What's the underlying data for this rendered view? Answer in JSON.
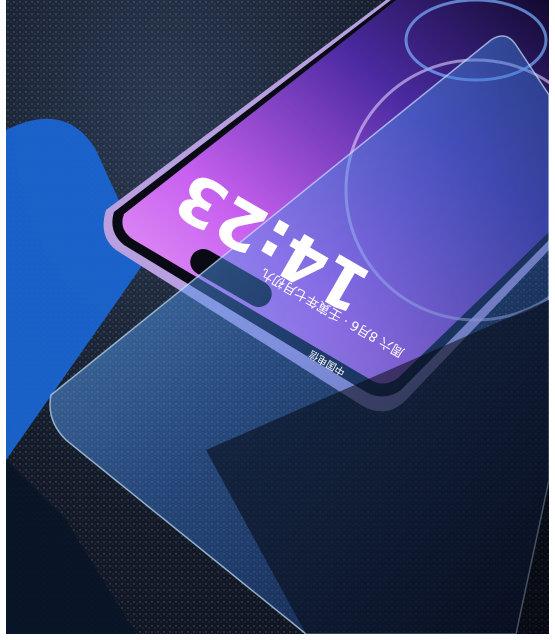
{
  "lockscreen": {
    "time": "14:23",
    "date": "周六 8月6 · 壬寅年七月初九",
    "carrier": "中国电信"
  },
  "colors": {
    "background": "#141b28",
    "screen_pink": "#d878f0",
    "screen_purple": "#4a2aa0",
    "frame": "#b8a0e0",
    "glass_blue": "#5aa8f0"
  }
}
